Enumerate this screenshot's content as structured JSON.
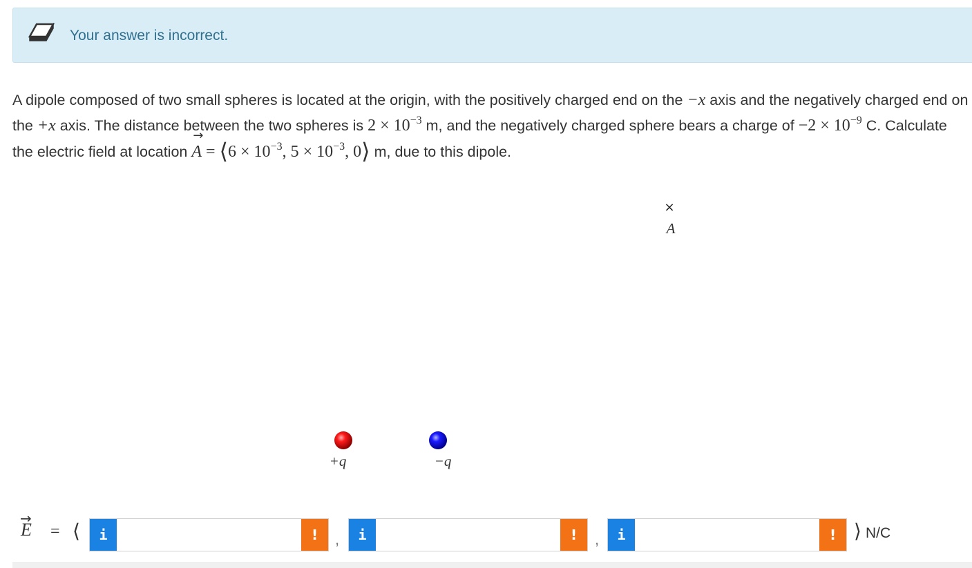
{
  "banner": {
    "icon": "eraser-icon",
    "message": "Your answer is incorrect.",
    "colors": {
      "background": "#d9edf7",
      "text": "#31708f"
    }
  },
  "question": {
    "text1": "A dipole composed of two small spheres is located at the origin, with the positively charged end on the ",
    "neg_x": "−x",
    "text2": " axis and the negatively charged end on the ",
    "pos_x": "+x",
    "text3": " axis. The distance between the two spheres is ",
    "dist_base": "2 × 10",
    "dist_exp": "−3",
    "text4": " m, and the negatively charged sphere bears a charge of ",
    "charge_base": "−2 × 10",
    "charge_exp": "−9",
    "text5": " C. Calculate the electric field at location ",
    "loc_var": "A",
    "loc_eq": "=",
    "loc_x_base": "6 × 10",
    "loc_x_exp": "−3",
    "loc_y_base": ", 5 × 10",
    "loc_y_exp": "−3",
    "loc_z": ", 0",
    "text6": " m, due to this dipole."
  },
  "diagram": {
    "point_marker": "×",
    "point_label": "A",
    "positive_label": "+q",
    "negative_label": "−q",
    "positive_color": "#e00000",
    "negative_color": "#0000d8"
  },
  "answer": {
    "variable": "E",
    "equals": "=",
    "open": "⟨",
    "close": "⟩",
    "unit": "N/C",
    "separator": ",",
    "info_label": "i",
    "error_label": "!",
    "fields": [
      {
        "value": ""
      },
      {
        "value": ""
      },
      {
        "value": ""
      }
    ],
    "colors": {
      "info": "#1a82e2",
      "error": "#f47216"
    }
  }
}
